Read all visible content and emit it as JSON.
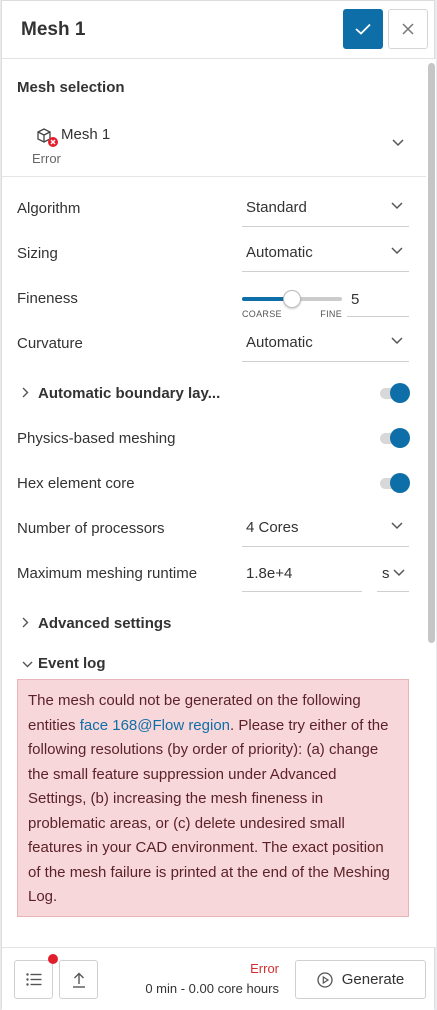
{
  "header": {
    "title": "Mesh 1"
  },
  "mesh_selection": {
    "title": "Mesh selection",
    "item_name": "Mesh 1",
    "item_status": "Error"
  },
  "settings": {
    "algorithm": {
      "label": "Algorithm",
      "value": "Standard"
    },
    "sizing": {
      "label": "Sizing",
      "value": "Automatic"
    },
    "fineness": {
      "label": "Fineness",
      "value": "5",
      "min_label": "COARSE",
      "max_label": "FINE",
      "level_fraction": 0.5
    },
    "curvature": {
      "label": "Curvature",
      "value": "Automatic"
    },
    "auto_boundary": {
      "label": "Automatic boundary lay...",
      "enabled": true
    },
    "physics_based": {
      "label": "Physics-based meshing",
      "enabled": true
    },
    "hex_core": {
      "label": "Hex element core",
      "enabled": true
    },
    "processors": {
      "label": "Number of processors",
      "value": "4 Cores"
    },
    "runtime": {
      "label": "Maximum meshing runtime",
      "value": "1.8e+4",
      "unit": "s"
    }
  },
  "advanced": {
    "label": "Advanced settings"
  },
  "event_log": {
    "label": "Event log",
    "message_before_link": "The mesh could not be generated on the following entities ",
    "link_text": "face 168@Flow region",
    "message_after_link": ". Please try either of the following resolutions (by order of priority): (a) change the small feature suppression under Advanced Settings, (b) increasing the mesh fineness in problematic areas, or (c) delete undesired small features in your CAD environment. The exact position of the mesh failure is printed at the end of the Meshing Log."
  },
  "footer": {
    "status": "Error",
    "core_hours": "0 min - 0.00 core hours",
    "generate_label": "Generate"
  },
  "colors": {
    "accent": "#0e6fa8",
    "error_bg": "#f8d7da",
    "error_text": "#d32f2f"
  }
}
